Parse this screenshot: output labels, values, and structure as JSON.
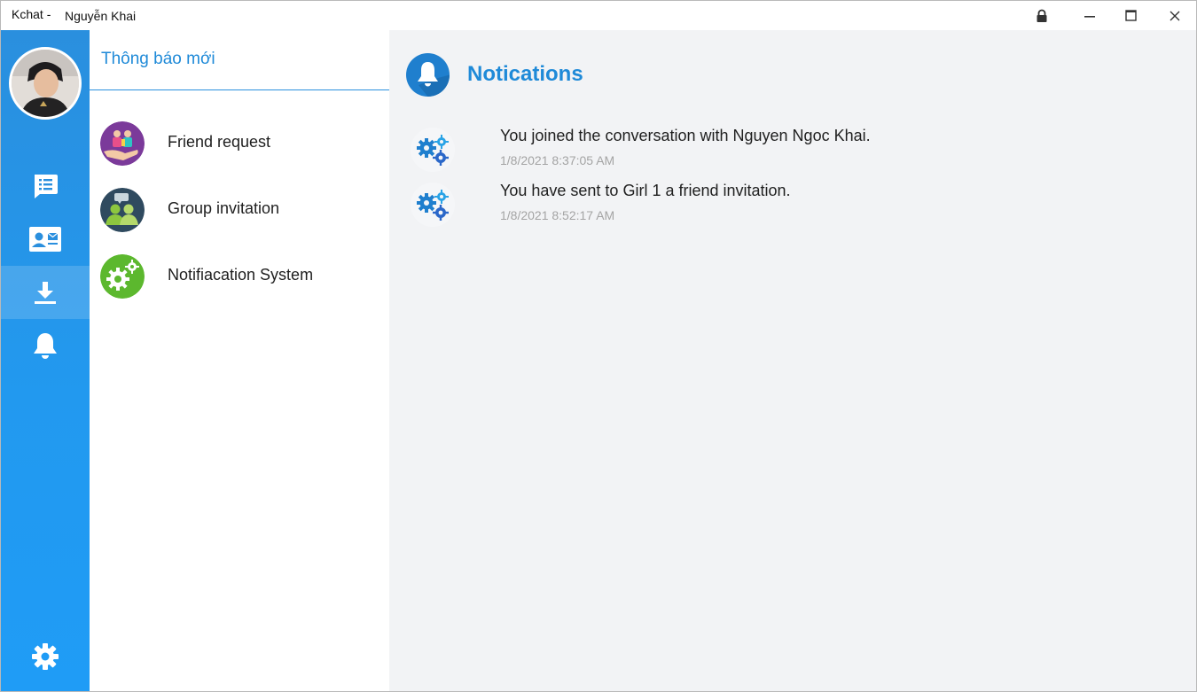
{
  "window": {
    "app_title": "Kchat -",
    "user_name": "Nguyễn Khai",
    "controls": [
      "lock-icon",
      "minimize-icon",
      "maximize-icon",
      "close-icon"
    ]
  },
  "sidebar": {
    "active_item": "download",
    "items": [
      {
        "id": "chat",
        "icon": "chat-list-icon"
      },
      {
        "id": "contacts",
        "icon": "contact-card-icon"
      },
      {
        "id": "download",
        "icon": "download-icon"
      },
      {
        "id": "notifications",
        "icon": "bell-icon"
      }
    ],
    "settings_icon": "gear-icon"
  },
  "list_panel": {
    "title": "Thông báo mới",
    "items": [
      {
        "label": "Friend request",
        "icon": "friend-request-icon"
      },
      {
        "label": "Group invitation",
        "icon": "group-invitation-icon"
      },
      {
        "label": "Notifiacation System",
        "icon": "system-gears-icon"
      }
    ]
  },
  "content": {
    "title": "Notications",
    "notifications": [
      {
        "text": "You joined the conversation with Nguyen Ngoc Khai.",
        "time": "1/8/2021 8:37:05 AM",
        "icon": "gears-icon"
      },
      {
        "text": "You have sent to Girl 1 a friend invitation.",
        "time": "1/8/2021 8:52:17 AM",
        "icon": "gears-icon"
      }
    ]
  },
  "colors": {
    "accent": "#1f8ad8",
    "rail_top": "#2a8fde",
    "rail_bottom": "#1f9cf6",
    "content_bg": "#f2f3f5",
    "timestamp": "#a4a4a4"
  }
}
